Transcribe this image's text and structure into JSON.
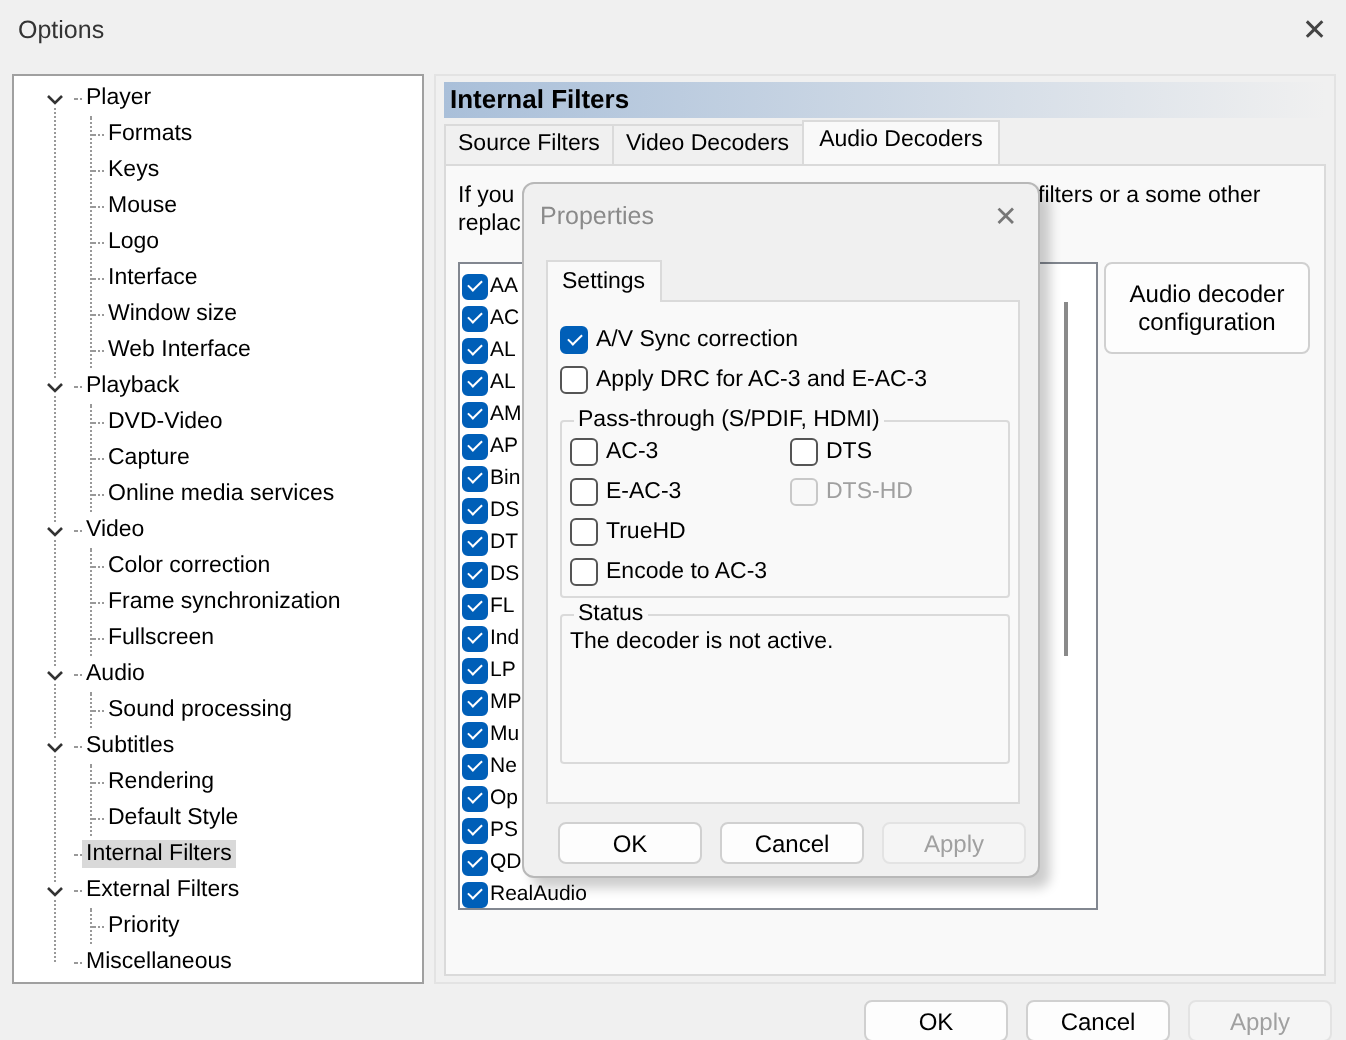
{
  "window": {
    "title": "Options",
    "close": "✕"
  },
  "tree": [
    {
      "label": "Player",
      "expanded": true,
      "selected": false,
      "children": [
        {
          "label": "Formats",
          "selected": false
        },
        {
          "label": "Keys",
          "selected": false
        },
        {
          "label": "Mouse",
          "selected": false
        },
        {
          "label": "Logo",
          "selected": false
        },
        {
          "label": "Interface",
          "selected": false
        },
        {
          "label": "Window size",
          "selected": false
        },
        {
          "label": "Web Interface",
          "selected": false
        }
      ]
    },
    {
      "label": "Playback",
      "expanded": true,
      "selected": false,
      "children": [
        {
          "label": "DVD-Video",
          "selected": false
        },
        {
          "label": "Capture",
          "selected": false
        },
        {
          "label": "Online media services",
          "selected": false
        }
      ]
    },
    {
      "label": "Video",
      "expanded": true,
      "selected": false,
      "children": [
        {
          "label": "Color correction",
          "selected": false
        },
        {
          "label": "Frame synchronization",
          "selected": false
        },
        {
          "label": "Fullscreen",
          "selected": false
        }
      ]
    },
    {
      "label": "Audio",
      "expanded": true,
      "selected": false,
      "children": [
        {
          "label": "Sound processing",
          "selected": false
        }
      ]
    },
    {
      "label": "Subtitles",
      "expanded": true,
      "selected": false,
      "children": [
        {
          "label": "Rendering",
          "selected": false
        },
        {
          "label": "Default Style",
          "selected": false
        }
      ]
    },
    {
      "label": "Internal Filters",
      "selected": true
    },
    {
      "label": "External Filters",
      "expanded": true,
      "selected": false,
      "children": [
        {
          "label": "Priority",
          "selected": false
        }
      ]
    },
    {
      "label": "Miscellaneous",
      "selected": false
    }
  ],
  "panel": {
    "title": "Internal Filters",
    "tabs": [
      {
        "label": "Source Filters",
        "selected": false
      },
      {
        "label": "Video Decoders",
        "selected": false
      },
      {
        "label": "Audio Decoders",
        "selected": true
      }
    ],
    "hint_left": [
      "If you",
      "replac"
    ],
    "hint_right": "filters or a some other",
    "filters": [
      {
        "label": "AA",
        "checked": true
      },
      {
        "label": "AC",
        "checked": true
      },
      {
        "label": "AL",
        "checked": true
      },
      {
        "label": "AL",
        "checked": true
      },
      {
        "label": "AM",
        "checked": true
      },
      {
        "label": "AP",
        "checked": true
      },
      {
        "label": "Bin",
        "checked": true
      },
      {
        "label": "DS",
        "checked": true
      },
      {
        "label": "DT",
        "checked": true
      },
      {
        "label": "DS",
        "checked": true
      },
      {
        "label": "FL",
        "checked": true
      },
      {
        "label": "Ind",
        "checked": true
      },
      {
        "label": "LP",
        "checked": true
      },
      {
        "label": "MP",
        "checked": true
      },
      {
        "label": "Mu",
        "checked": true
      },
      {
        "label": "Ne",
        "checked": true
      },
      {
        "label": "Op",
        "checked": true
      },
      {
        "label": "PS",
        "checked": true
      },
      {
        "label": "QD",
        "checked": true
      },
      {
        "label": "RealAudio",
        "checked": true
      }
    ],
    "config_button": "Audio decoder configuration"
  },
  "dialog": {
    "title": "Properties",
    "close": "✕",
    "tabs": [
      {
        "label": "Settings",
        "selected": true
      }
    ],
    "options": [
      {
        "label": "A/V Sync correction",
        "checked": true
      },
      {
        "label": "Apply DRC for AC-3 and E-AC-3",
        "checked": false
      }
    ],
    "passthrough": {
      "title": "Pass-through (S/PDIF, HDMI)",
      "options": [
        {
          "label": "AC-3",
          "checked": false,
          "disabled": false
        },
        {
          "label": "DTS",
          "checked": false,
          "disabled": false
        },
        {
          "label": "E-AC-3",
          "checked": false,
          "disabled": false
        },
        {
          "label": "DTS-HD",
          "checked": false,
          "disabled": true
        },
        {
          "label": "TrueHD",
          "checked": false,
          "disabled": false
        },
        {
          "label": "Encode to AC-3",
          "checked": false,
          "disabled": false
        }
      ]
    },
    "status": {
      "title": "Status",
      "text": "The decoder is not active."
    },
    "buttons": [
      {
        "label": "OK",
        "disabled": false
      },
      {
        "label": "Cancel",
        "disabled": false
      },
      {
        "label": "Apply",
        "disabled": true
      }
    ]
  },
  "buttons": [
    {
      "label": "OK",
      "disabled": false
    },
    {
      "label": "Cancel",
      "disabled": false
    },
    {
      "label": "Apply",
      "disabled": true
    }
  ]
}
